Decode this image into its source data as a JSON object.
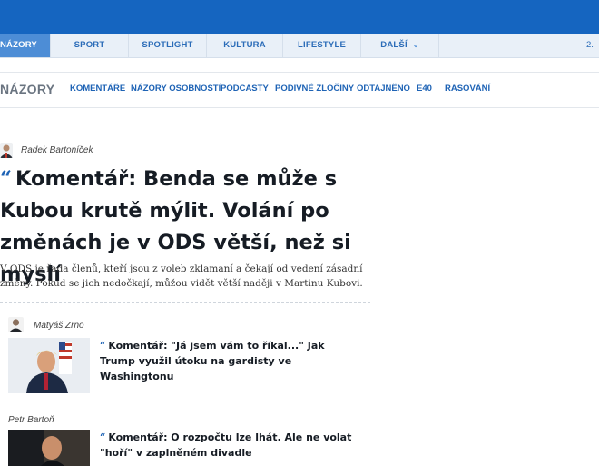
{
  "main_nav": {
    "items": [
      {
        "label": "NÁZORY"
      },
      {
        "label": "SPORT"
      },
      {
        "label": "SPOTLIGHT"
      },
      {
        "label": "KULTURA"
      },
      {
        "label": "LIFESTYLE"
      },
      {
        "label": "DALŠÍ"
      }
    ],
    "date_fragment": "2."
  },
  "sub_nav": {
    "brand": "NÁZORY",
    "items": [
      {
        "label": "KOMENTÁŘE"
      },
      {
        "label": "NÁZORY OSOBNOSTÍ"
      },
      {
        "label": "PODCASTY"
      },
      {
        "label": "PODIVNÉ ZLOČINY"
      },
      {
        "label": "ODTAJNĚNO"
      },
      {
        "label": "E40"
      },
      {
        "label": "RASOVÁNÍ"
      }
    ]
  },
  "lead_article": {
    "author": "Radek Bartoníček",
    "title": "Komentář: Benda se může s Kubou krutě mýlit. Volání po změnách je v ODS větší, než si myslí",
    "perex": "V ODS je řada členů, kteří jsou z voleb zklamaní a čekají od vedení zásadní změny. Pokud se jich nedočkají, můžou vidět větší naději v Martinu Kubovi."
  },
  "articles": [
    {
      "author": "Matyáš Zrno",
      "title": "Komentář: \"Já jsem vám to říkal...\" Jak Trump využil útoku na gardisty ve Washingtonu"
    },
    {
      "author": "Petr Bartoň",
      "title": "Komentář: O rozpočtu lze lhát. Ale ne volat \"hoří\" v zaplněném divadle"
    }
  ],
  "colors": {
    "brand_blue": "#1565c0",
    "link_blue": "#1e63b5",
    "nav_bg": "#e9f0f8"
  }
}
